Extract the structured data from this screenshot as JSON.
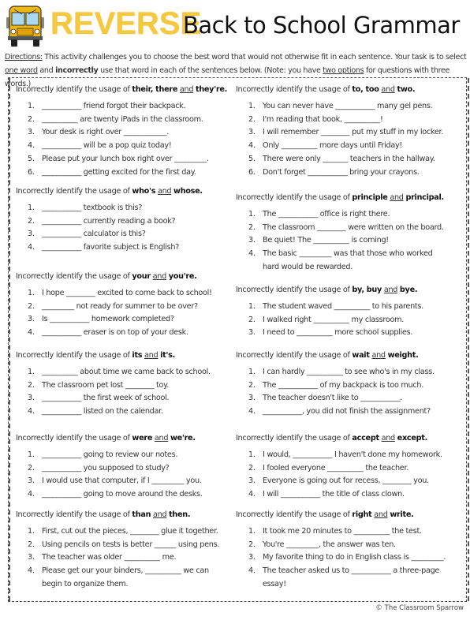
{
  "header": {
    "title_highlight": "REVERSE",
    "title_rest": "Back to School Grammar",
    "bus_icon": "school-bus-icon"
  },
  "directions": {
    "label": "Directions:",
    "text_1": " This activity challenges you to choose the best word that would not otherwise fit in each sentence. Your task is to select ",
    "one_word": "one word",
    "text_2": " and ",
    "incorrectly": "incorrectly",
    "text_3": " use that word in each of the sentences below. (Note: you have ",
    "two_options": "two options",
    "text_4": " for questions with three words.)"
  },
  "sections_left": [
    {
      "prefix": "Incorrectly identify the usage of ",
      "words": [
        "their, there",
        "they're."
      ],
      "items": [
        {
          "num": "1.",
          "text": "___________ friend forgot their backpack."
        },
        {
          "num": "2.",
          "text": "__________ are twenty iPads in the classroom."
        },
        {
          "num": "3.",
          "text": "Your desk is right over ____________."
        },
        {
          "num": "4.",
          "text": "___________ will be a pop quiz today!"
        },
        {
          "num": "5.",
          "text": "Please put your lunch box right over _________."
        },
        {
          "num": "6.",
          "text": "___________ getting excited for the first day."
        }
      ]
    },
    {
      "prefix": "Incorrectly identify the usage of ",
      "words": [
        "who's",
        "whose."
      ],
      "items": [
        {
          "num": "1.",
          "text": "___________ textbook is this?"
        },
        {
          "num": "2.",
          "text": "___________ currently reading a book?"
        },
        {
          "num": "3.",
          "text": "___________ calculator is this?"
        },
        {
          "num": "4.",
          "text": "___________ favorite subject is English?"
        }
      ]
    },
    {
      "prefix": "Incorrectly identify the usage of ",
      "words": [
        "your",
        "you're."
      ],
      "items": [
        {
          "num": "1.",
          "text": "I hope ________ excited to come back to school!"
        },
        {
          "num": "2.",
          "text": "_________ not ready for summer to be over?"
        },
        {
          "num": "3.",
          "text": "Is ___________ homework completed?"
        },
        {
          "num": "4.",
          "text": "___________ eraser is on top of your desk."
        }
      ]
    },
    {
      "prefix": "Incorrectly identify the usage of ",
      "words": [
        "its",
        "it's."
      ],
      "items": [
        {
          "num": "1.",
          "text": "__________ about time we came back to school."
        },
        {
          "num": "2.",
          "text": "The classroom pet lost ________ toy."
        },
        {
          "num": "3.",
          "text": "___________ the first week of school."
        },
        {
          "num": "4.",
          "text": "___________ listed on the calendar."
        }
      ]
    },
    {
      "prefix": "Incorrectly identify the usage of ",
      "words": [
        "were",
        "we're."
      ],
      "items": [
        {
          "num": "1.",
          "text": "___________ going to review our notes."
        },
        {
          "num": "2.",
          "text": "___________ you supposed to study?"
        },
        {
          "num": "3.",
          "text": "I would use that computer, if I _________ you."
        },
        {
          "num": "4.",
          "text": "___________ going to move around the desks."
        }
      ]
    },
    {
      "prefix": "Incorrectly identify the usage of ",
      "words": [
        "than",
        "then."
      ],
      "items": [
        {
          "num": "1.",
          "text": "First, cut out the pieces, ________ glue it together."
        },
        {
          "num": "2.",
          "text": "Using pencils on tests is better ______ using pens."
        },
        {
          "num": "3.",
          "text": "The teacher was older __________ me."
        },
        {
          "num": "4.",
          "text": "Please get our your binders, __________ we can begin to organize them.",
          "wrap": true
        }
      ]
    }
  ],
  "sections_right": [
    {
      "prefix": "Incorrectly identify the usage of ",
      "words": [
        "to, too",
        "two."
      ],
      "items": [
        {
          "num": "1.",
          "text": "You can never have ___________ many gel pens."
        },
        {
          "num": "2.",
          "text": "I'm reading that book, __________!"
        },
        {
          "num": "3.",
          "text": "I will remember ________ put my stuff in my locker."
        },
        {
          "num": "4.",
          "text": "Only __________ more days until Friday!"
        },
        {
          "num": "5.",
          "text": "There were only _______ teachers in the hallway."
        },
        {
          "num": "6.",
          "text": "Don't forget ___________ bring your crayons."
        }
      ]
    },
    {
      "prefix": "Incorrectly identify the usage of ",
      "words": [
        "principle",
        "principal."
      ],
      "items": [
        {
          "num": "1.",
          "text": "The ___________ office is right there."
        },
        {
          "num": "2.",
          "text": "The classroom ________ were written on the board."
        },
        {
          "num": "3.",
          "text": "Be quiet! The __________ is coming!"
        },
        {
          "num": "4.",
          "text": "The basic _________ was that those who worked hard would be rewarded.",
          "wrap": true
        }
      ]
    },
    {
      "prefix": "Incorrectly identify the usage of ",
      "words": [
        "by, buy",
        "bye."
      ],
      "items": [
        {
          "num": "1.",
          "text": "The student waved __________ to his parents."
        },
        {
          "num": "2.",
          "text": "I walked right __________ my classroom."
        },
        {
          "num": "3.",
          "text": "I need to __________ more school supplies."
        }
      ]
    },
    {
      "prefix": "Incorrectly identify the usage of ",
      "words": [
        "wait",
        "weight."
      ],
      "items": [
        {
          "num": "1.",
          "text": "I can hardly __________ to see who's in my class."
        },
        {
          "num": "2.",
          "text": "The ___________ of my backpack is too much."
        },
        {
          "num": "3.",
          "text": "The teacher doesn't like to ___________."
        },
        {
          "num": "4.",
          "text": "___________, you did not finish the assignment?"
        }
      ]
    },
    {
      "prefix": "Incorrectly identify the usage of ",
      "words": [
        "accept",
        "except."
      ],
      "items": [
        {
          "num": "1.",
          "text": "I would, ___________ I haven't done my homework."
        },
        {
          "num": "2.",
          "text": "I fooled everyone __________ the teacher."
        },
        {
          "num": "3.",
          "text": "Everyone is going out for recess, ________ you."
        },
        {
          "num": "4.",
          "text": "I will ___________ the title of class clown."
        }
      ]
    },
    {
      "prefix": "Incorrectly identify the usage of ",
      "words": [
        "right",
        "write."
      ],
      "items": [
        {
          "num": "1.",
          "text": "It took me 20 minutes to __________ the test."
        },
        {
          "num": "2.",
          "text": "You're _________, the answer was ten."
        },
        {
          "num": "3.",
          "text": "My favorite thing to do in English class is _________."
        },
        {
          "num": "4.",
          "text": "The teacher asked us to ___________ a three-page essay!",
          "wrap": true
        }
      ]
    }
  ],
  "and_word": "and",
  "footer": "© The Classroom Sparrow",
  "colors": {
    "title_yellow": "#f5c842",
    "text": "#333333"
  }
}
